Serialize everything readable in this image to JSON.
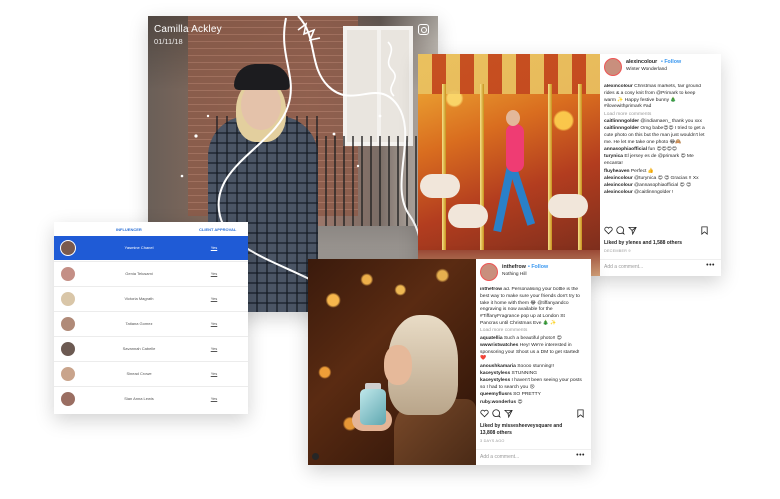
{
  "story": {
    "name": "Camilla Ackley",
    "date": "01/11/18",
    "camera_icon": "instagram-camera-icon"
  },
  "table": {
    "headers": {
      "influencer": "INFLUENCER",
      "approval": "CLIENT APPROVAL"
    },
    "rows": [
      {
        "name": "Yasmine Chanel",
        "approval": "Yes",
        "selected": true
      },
      {
        "name": "Genia Telusami",
        "approval": "Yes",
        "selected": false
      },
      {
        "name": "Victoria Magrath",
        "approval": "Yes",
        "selected": false
      },
      {
        "name": "Tatiana Gomez",
        "approval": "Yes",
        "selected": false
      },
      {
        "name": "Savannah Cabelle",
        "approval": "Yes",
        "selected": false
      },
      {
        "name": "Sinead Crowe",
        "approval": "Yes",
        "selected": false
      },
      {
        "name": "Sian Anna Lewis",
        "approval": "Yes",
        "selected": false
      }
    ]
  },
  "post1": {
    "username": "alexincolour",
    "follow": "• Follow",
    "location": "Winter Wonderland",
    "caption_user": "alexincolour",
    "caption": "Christmas markets, fair ground rides & a cosy knit from @Primark to keep warm ✨ Happy festive bunny 🎄 #ilovewithprimark #ad",
    "load_more": "Load more comments",
    "comments": [
      {
        "user": "caitlinnngolder",
        "text": "@indiamaen_ thank you xxx"
      },
      {
        "user": "caitlinnngolder",
        "text": "Omg babe😍😍 I tried to get a cute photo on this but the man just wouldn't let me. He let me take one photo 😂🙈"
      },
      {
        "user": "annasophiaofficial",
        "text": "fun 😍😍😍😍"
      },
      {
        "user": "turynica",
        "text": "El jersey es de @primark 😍 Me encanta!"
      },
      {
        "user": "fluyheaven",
        "text": "Perfect 👍"
      },
      {
        "user": "alexincolour",
        "text": "@turynica 😍 😍 Gracias !! Xx"
      },
      {
        "user": "alexincolour",
        "text": "@annasophiaofficial 😍 😍"
      },
      {
        "user": "alexincolour",
        "text": "@caitlinnngolder !"
      }
    ],
    "likes": "Liked by ylenes and 1,588 others",
    "date": "DECEMBER 9",
    "add_comment": "Add a comment...",
    "more": "•••"
  },
  "post2": {
    "username": "inthefrow",
    "follow": "• Follow",
    "location": "Nothing Hill",
    "caption_user": "inthefrow",
    "caption": "ad. Personalising your bottle is the best way to make sure your friends don't try to take it home with them 😂 @tiffanyandco engraving is now available for the #TiffanyFragrance pop up at London St Pancras until Christmas Eve 🎄 ✨",
    "load_more": "Load more comments",
    "comments": [
      {
        "user": "aquatellia",
        "text": "Such a beautiful photo!! 😍"
      },
      {
        "user": "wwwristwatches",
        "text": "Hey! We're interested in sponsoring you! Shoot us a DM to get started! ❤️"
      },
      {
        "user": "anoushkamaria",
        "text": "Soooo stunning!!"
      },
      {
        "user": "kaceystyless",
        "text": "STUNNING"
      },
      {
        "user": "kaceystyless",
        "text": "I haven't been seeing your posts so I had to search you 😢"
      },
      {
        "user": "queemyflusrs",
        "text": "SO PRETTY"
      },
      {
        "user": "ruby.wonderlus",
        "text": "😍"
      }
    ],
    "likes_line1": "Liked by missesheeveysquare and",
    "likes_line2": "13,808 others",
    "date": "3 DAYS AGO",
    "add_comment": "Add a comment...",
    "more": "•••"
  }
}
